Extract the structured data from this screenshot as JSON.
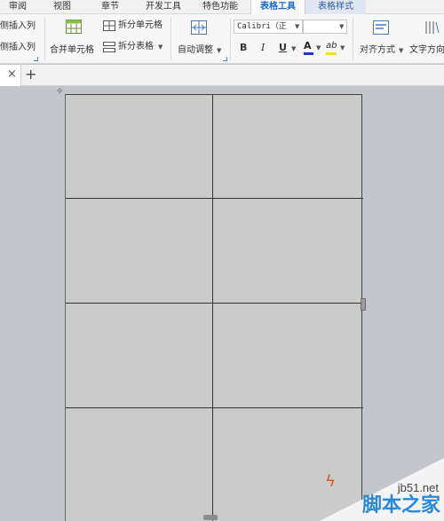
{
  "menubar": {
    "tabs": [
      {
        "label": "审阅"
      },
      {
        "label": "视图"
      },
      {
        "label": "章节"
      },
      {
        "label": "开发工具"
      },
      {
        "label": "特色功能"
      },
      {
        "label": "表格工具"
      },
      {
        "label": "表格样式"
      }
    ],
    "active_tab": "表格工具"
  },
  "ribbon": {
    "insert_col_left": "侧插入列",
    "insert_col_right": "侧插入列",
    "merge_cells": "合并单元格",
    "split_cells": "拆分单元格",
    "split_table": "拆分表格",
    "autofit": "自动调整",
    "font_name": "Calibri（正",
    "font_size": "",
    "bold": "B",
    "italic": "I",
    "underline": "U",
    "font_color": "A",
    "highlight": "ab",
    "align": "对齐方式",
    "text_direction": "文字方向"
  },
  "doctabs": {
    "close": "×",
    "add": "+"
  },
  "watermark": {
    "site": "jb51.net",
    "name": "脚本之家"
  },
  "colors": {
    "accent": "#1e6fd1",
    "canvas": "#c3c7cc",
    "page": "#cbcbcb",
    "grid": "#333333"
  }
}
